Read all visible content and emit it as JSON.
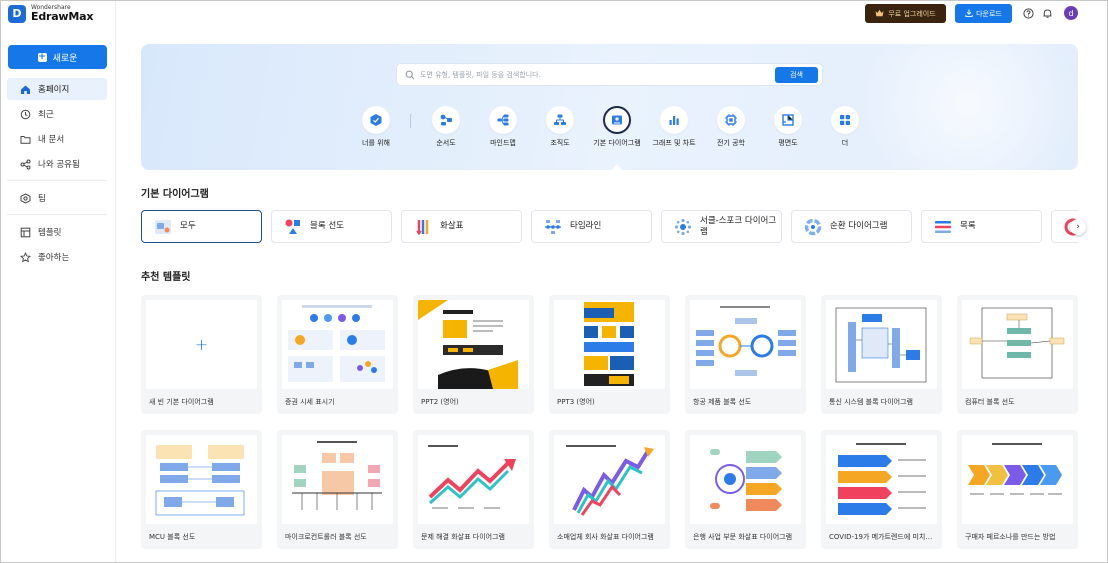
{
  "app": {
    "brand_small": "Wondershare",
    "brand_big": "EdrawMax",
    "logo_letter": "D"
  },
  "sidebar": {
    "new_button": "새로운",
    "items": [
      {
        "label": "홈페이지",
        "icon": "home-icon",
        "active": true
      },
      {
        "label": "최근",
        "icon": "clock-icon"
      },
      {
        "label": "내 문서",
        "icon": "folder-icon"
      },
      {
        "label": "나와 공유됨",
        "icon": "share-icon"
      },
      {
        "label": "팀",
        "icon": "team-icon"
      },
      {
        "label": "템플릿",
        "icon": "template-icon"
      },
      {
        "label": "좋아하는",
        "icon": "star-icon"
      }
    ]
  },
  "topbar": {
    "upgrade_label": "무료 업그레이드",
    "download_label": "다운로드",
    "avatar_letter": "d"
  },
  "hero": {
    "search_placeholder": "도면 유형, 템플릿, 파일 등을 검색합니다.",
    "search_button": "검색",
    "categories": [
      {
        "label": "너를 위해",
        "icon": "for-you-icon"
      },
      {
        "label": "순서도",
        "icon": "flowchart-icon"
      },
      {
        "label": "마인드맵",
        "icon": "mindmap-icon"
      },
      {
        "label": "조직도",
        "icon": "org-chart-icon"
      },
      {
        "label": "기본 다이어그램",
        "icon": "basic-diagram-icon",
        "active": true
      },
      {
        "label": "그래프 및 차트",
        "icon": "graph-chart-icon"
      },
      {
        "label": "전기 공학",
        "icon": "electrical-icon"
      },
      {
        "label": "평면도",
        "icon": "floor-plan-icon"
      },
      {
        "label": "더",
        "icon": "more-icon"
      }
    ]
  },
  "basic_section": {
    "title": "기본 다이어그램",
    "chips": [
      {
        "label": "모두",
        "active": true
      },
      {
        "label": "블록 선도"
      },
      {
        "label": "화살표"
      },
      {
        "label": "타임라인"
      },
      {
        "label": "서클-스포크 다이어그램"
      },
      {
        "label": "순환 다이어그램"
      },
      {
        "label": "목록"
      }
    ]
  },
  "recommended": {
    "title": "추천 템플릿",
    "templates": [
      {
        "label": "새 빈 기본 다이어그램",
        "kind": "blank"
      },
      {
        "label": "증권 시세 표시기"
      },
      {
        "label": "PPT2 (영어)"
      },
      {
        "label": "PPT3 (영어)"
      },
      {
        "label": "항공 제품 블록 선도"
      },
      {
        "label": "통신 시스템 블록 다이어그램"
      },
      {
        "label": "컴퓨터 블록 선도"
      },
      {
        "label": "MCU 블록 선도"
      },
      {
        "label": "마이크로컨트롤러 블록 선도"
      },
      {
        "label": "문제 해결 화살표 다이어그램"
      },
      {
        "label": "소매업체 회사 화살표 다이어그램"
      },
      {
        "label": "은행 사업 부문 화살표 다이어그램"
      },
      {
        "label": "COVID-19가 메가트렌드에 미치는 영향"
      },
      {
        "label": "구매자 페르소나를 만드는 방법"
      }
    ]
  },
  "colors": {
    "accent": "#1677e8",
    "upgrade_bg": "#3a2410",
    "hero_bg": "#dfeafb"
  }
}
